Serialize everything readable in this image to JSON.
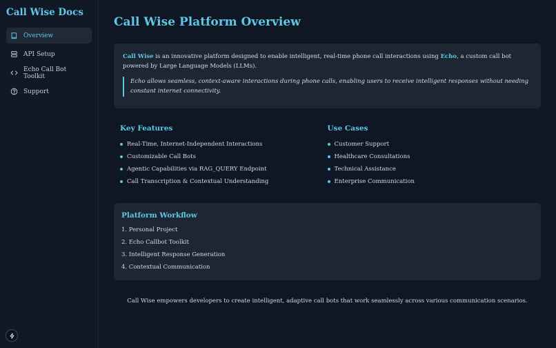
{
  "sidebar": {
    "brand": "Call Wise Docs",
    "items": [
      {
        "label": "Overview",
        "icon": "book-icon",
        "active": true
      },
      {
        "label": "API Setup",
        "icon": "server-icon",
        "active": false
      },
      {
        "label": "Echo Call Bot Toolkit",
        "icon": "code-icon",
        "active": false
      },
      {
        "label": "Support",
        "icon": "help-circle-icon",
        "active": false
      }
    ],
    "footer_icon": "bolt-icon"
  },
  "main": {
    "title": "Call Wise Platform Overview",
    "intro": {
      "brand": "Call Wise",
      "text_1": " is an innovative platform designed to enable intelligent, real-time phone call interactions using ",
      "echo": "Echo",
      "text_2": ", a custom call bot powered by Large Language Models (LLMs).",
      "quote": "Echo allows seamless, context-aware interactions during phone calls, enabling users to receive intelligent responses without needing constant internet connectivity."
    },
    "features": {
      "title": "Key Features",
      "items": [
        "Real-Time, Internet-Independent Interactions",
        "Customizable Call Bots",
        "Agentic Capabilities via RAG_QUERY Endpoint",
        "Call Transcription & Contextual Understanding"
      ]
    },
    "use_cases": {
      "title": "Use Cases",
      "items": [
        "Customer Support",
        "Healthcare Consultations",
        "Technical Assistance",
        "Enterprise Communication"
      ]
    },
    "workflow": {
      "title": "Platform Workflow",
      "items": [
        "1. Personal Project",
        "2. Echo Callbot Toolkit",
        "3. Intelligent Response Generation",
        "4. Contextual Communication"
      ]
    },
    "closing": "Call Wise empowers developers to create intelligent, adaptive call bots that work seamlessly across various communication scenarios."
  },
  "colors": {
    "accent": "#5ec8e6",
    "background": "#0f1724",
    "card": "#1d2633"
  }
}
